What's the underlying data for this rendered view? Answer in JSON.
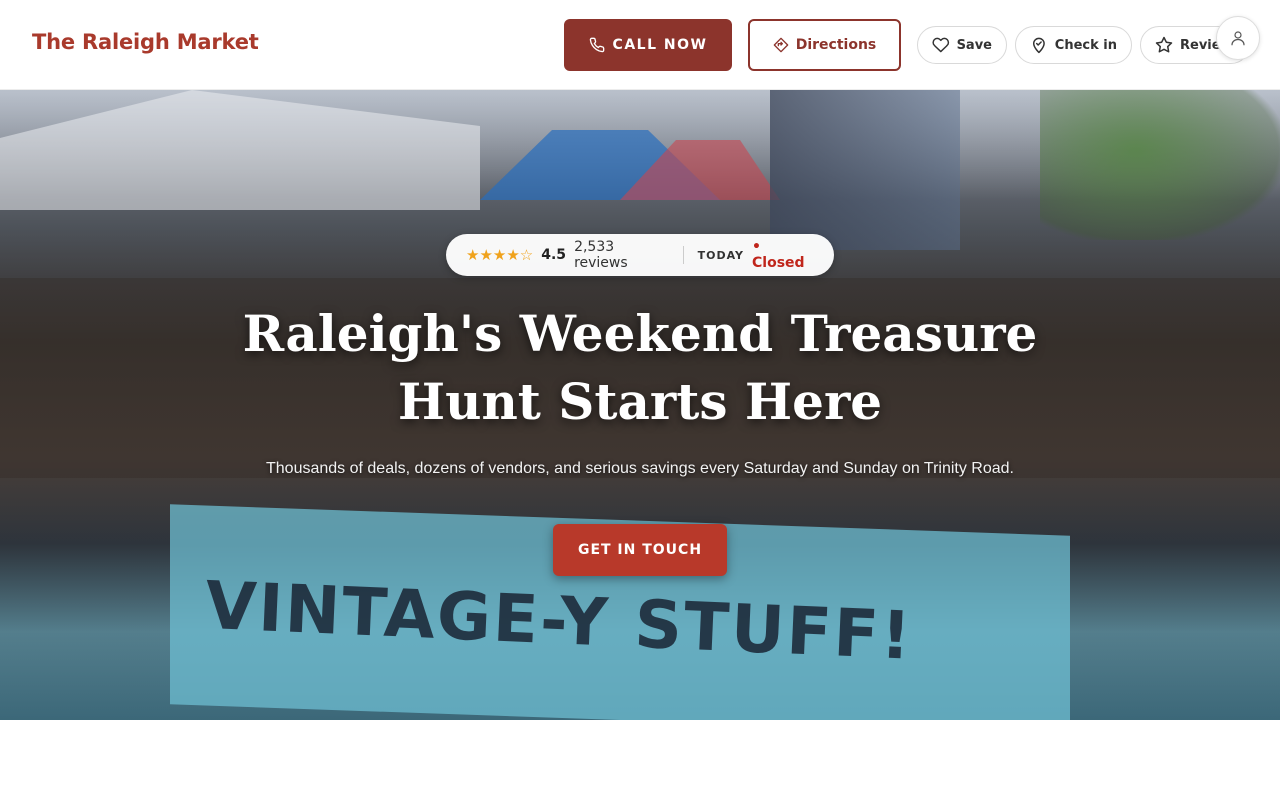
{
  "header": {
    "brand": "The Raleigh Market",
    "call_label": "CALL NOW",
    "directions_label": "Directions",
    "save_label": "Save",
    "checkin_label": "Check in",
    "review_label": "Review",
    "icons": {
      "call": "phone-icon",
      "directions": "directions-diamond-icon",
      "save": "heart-icon",
      "checkin": "map-pin-icon",
      "review": "star-icon",
      "account": "user-icon"
    }
  },
  "hero": {
    "rating_stars": "★★★★☆",
    "rating_value": "4.5",
    "review_count": "2,533 reviews",
    "today_label": "TODAY",
    "status": "• Closed",
    "title": "Raleigh's Weekend Treasure Hunt Starts Here",
    "subtitle": "Thousands of deals, dozens of vendors, and serious savings every Saturday and Sunday on Trinity Road.",
    "cta_label": "GET IN TOUCH",
    "photo_sign": "VINTAGE-Y STUFF!"
  },
  "colors": {
    "brand": "#a93a2c",
    "primary_button": "#8c342c",
    "cta": "#b8392a",
    "star": "#f0a21b",
    "closed": "#c0261c"
  }
}
